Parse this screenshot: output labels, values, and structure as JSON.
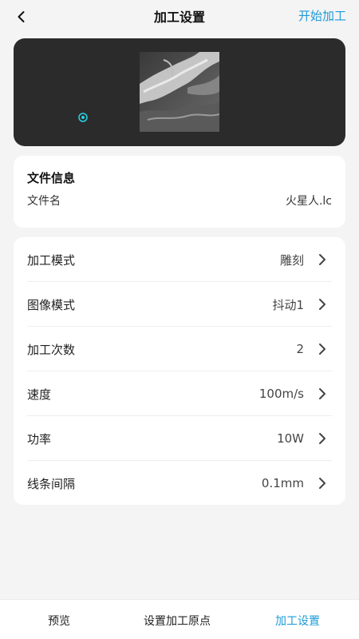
{
  "header": {
    "title": "加工设置",
    "back_icon": "chevron-left-icon",
    "start_label": "开始加工"
  },
  "preview": {
    "origin_icon": "target-icon",
    "thumbnail": "processing-image-thumbnail"
  },
  "file_info": {
    "title": "文件信息",
    "file_name_label": "文件名",
    "file_name_value": "火星人.lc"
  },
  "settings": [
    {
      "label": "加工模式",
      "value": "雕刻"
    },
    {
      "label": "图像模式",
      "value": "抖动1"
    },
    {
      "label": "加工次数",
      "value": "2"
    },
    {
      "label": "速度",
      "value": "100m/s"
    },
    {
      "label": "功率",
      "value": "10W"
    },
    {
      "label": "线条间隔",
      "value": "0.1mm"
    }
  ],
  "bottom_bar": {
    "tabs": [
      {
        "label": "预览",
        "active": false
      },
      {
        "label": "设置加工原点",
        "active": false
      },
      {
        "label": "加工设置",
        "active": true
      }
    ]
  },
  "colors": {
    "accent": "#1d9bd7",
    "preview_bg": "#2b2b2b",
    "origin_marker": "#2ad1e6",
    "page_bg": "#f4f4f5"
  }
}
